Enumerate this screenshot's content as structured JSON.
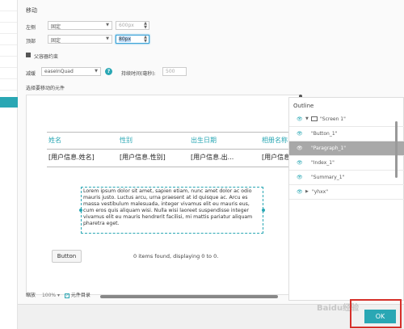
{
  "section_title": "移动",
  "left_label": "左侧",
  "left_mode": "固定",
  "left_value": "600px",
  "top_label": "顶部",
  "top_mode": "固定",
  "top_value": "80px",
  "parent_constraint": "父容器约束",
  "easing_label": "减缓",
  "easing_value": "easeInQuad",
  "duration_label": "持续时间(毫秒):",
  "duration_value": "500",
  "select_widget": "选择要移动的元件",
  "table": {
    "headers": [
      "姓名",
      "性别",
      "出生日期",
      "相册名称"
    ],
    "row": [
      "[用户信息.姓名]",
      "[用户信息.性别]",
      "[用户信息.出...",
      "[用户信息"
    ]
  },
  "paragraph": "Lorem ipsum dolor sit amet, sapien etiam, nunc amet dolor ac odio mauris justo. Luctus arcu, urna praesent at id quisque ac. Arcu es massa vestibulum malesuada, integer vivamus elit eu mauris eus, cum eros quis aliquam wisi. Nulla wisi laoreet suspendisse integer vivamus elit eu mauris hendrerit facilisi, mi mattis pariatur aliquam pharetra eget.",
  "sample_button": "Button",
  "items_found": "0 items found, displaying 0 to 0.",
  "zoom_label": "缩放",
  "zoom_value": "100%",
  "widget_list_label": "元件目录",
  "outline": {
    "title": "Outline",
    "items": [
      "\"Screen 1\"",
      "\"Button_1\"",
      "\"Paragraph_1\"",
      "\"Index_1\"",
      "\"Summary_1\"",
      "\"yhxx\""
    ]
  },
  "ok_button": "OK",
  "watermark": "Baidu经验",
  "icons": [
    "eye-icon",
    "triangle-down-icon",
    "triangle-right-icon",
    "monitor-icon",
    "help-icon",
    "checkbox-icon"
  ],
  "colors": {
    "accent": "#2aa7b4",
    "selected": "#a8a8a8",
    "highlight": "#d6302a"
  }
}
